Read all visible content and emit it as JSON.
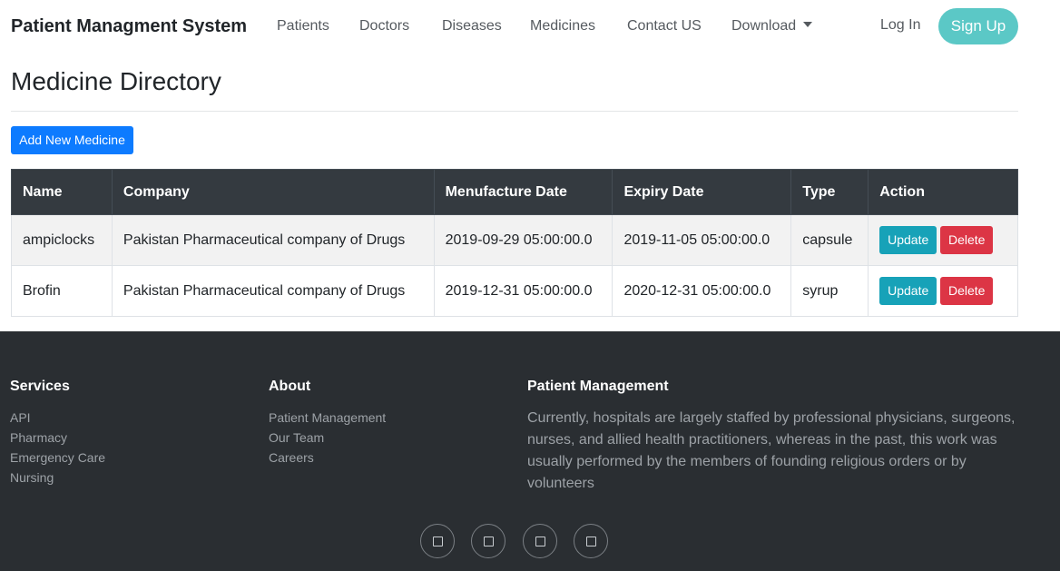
{
  "navbar": {
    "brand": "Patient Managment System",
    "items": [
      {
        "label": "Patients"
      },
      {
        "label": "Doctors"
      },
      {
        "label": "Diseases"
      },
      {
        "label": "Medicines"
      },
      {
        "label": "Contact US"
      },
      {
        "label": "Download"
      }
    ],
    "login": "Log In",
    "signup": "Sign Up"
  },
  "main": {
    "title": "Medicine Directory",
    "add_button": "Add New Medicine",
    "table": {
      "headers": [
        "Name",
        "Company",
        "Menufacture Date",
        "Expiry Date",
        "Type",
        "Action"
      ],
      "rows": [
        {
          "name": "ampiclocks",
          "company": "Pakistan Pharmaceutical company of Drugs",
          "manufacture_date": "2019-09-29 05:00:00.0",
          "expiry_date": "2019-11-05 05:00:00.0",
          "type": "capsule",
          "update": "Update",
          "delete": "Delete"
        },
        {
          "name": "Brofin",
          "company": "Pakistan Pharmaceutical company of Drugs",
          "manufacture_date": "2019-12-31 05:00:00.0",
          "expiry_date": "2020-12-31 05:00:00.0",
          "type": "syrup",
          "update": "Update",
          "delete": "Delete"
        }
      ]
    }
  },
  "footer": {
    "services": {
      "heading": "Services",
      "links": [
        "API",
        "Pharmacy",
        "Emergency Care",
        "Nursing"
      ]
    },
    "about": {
      "heading": "About",
      "links": [
        "Patient Management",
        "Our Team",
        "Careers"
      ]
    },
    "patient_management": {
      "heading": "Patient Management",
      "text": "Currently, hospitals are largely staffed by professional physicians, surgeons, nurses, and allied health practitioners, whereas in the past, this work was usually performed by the members of founding religious orders or by volunteers"
    },
    "social_icons": [
      "social-icon",
      "social-icon",
      "social-icon",
      "social-icon"
    ]
  },
  "colors": {
    "brand_button": "#5bc8c6",
    "primary": "#0d7bff",
    "update": "#17a2b8",
    "delete": "#dc3545",
    "table_header": "#343a40",
    "footer_bg": "#2a2e32"
  }
}
